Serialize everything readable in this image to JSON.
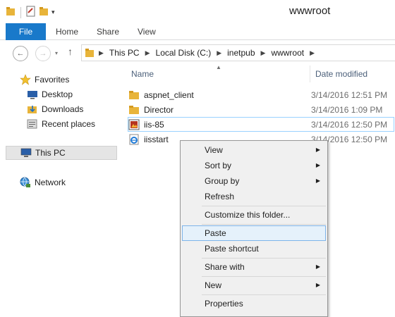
{
  "window": {
    "title": "wwwroot"
  },
  "ribbon": {
    "tabs": [
      {
        "label": "File"
      },
      {
        "label": "Home"
      },
      {
        "label": "Share"
      },
      {
        "label": "View"
      }
    ]
  },
  "address": {
    "crumbs": [
      "This PC",
      "Local Disk (C:)",
      "inetpub",
      "wwwroot"
    ]
  },
  "nav": {
    "favorites": "Favorites",
    "desktop": "Desktop",
    "downloads": "Downloads",
    "recent": "Recent places",
    "thispc": "This PC",
    "network": "Network"
  },
  "columns": {
    "name": "Name",
    "date": "Date modified"
  },
  "files": [
    {
      "name": "aspnet_client",
      "date": "3/14/2016 12:51 PM",
      "icon": "folder-icon"
    },
    {
      "name": "Director",
      "date": "3/14/2016 1:09 PM",
      "icon": "folder-icon"
    },
    {
      "name": "iis-85",
      "date": "3/14/2016 12:50 PM",
      "icon": "image-file-icon"
    },
    {
      "name": "iisstart",
      "date": "3/14/2016 12:50 PM",
      "icon": "ie-html-icon"
    }
  ],
  "context_menu": {
    "view": "View",
    "sort_by": "Sort by",
    "group_by": "Group by",
    "refresh": "Refresh",
    "customize": "Customize this folder...",
    "paste": "Paste",
    "paste_shortcut": "Paste shortcut",
    "share_with": "Share with",
    "new": "New",
    "properties": "Properties"
  },
  "colors": {
    "accent": "#1979ca",
    "folder": "#e8b43a",
    "hover": "#e5f1fb"
  }
}
